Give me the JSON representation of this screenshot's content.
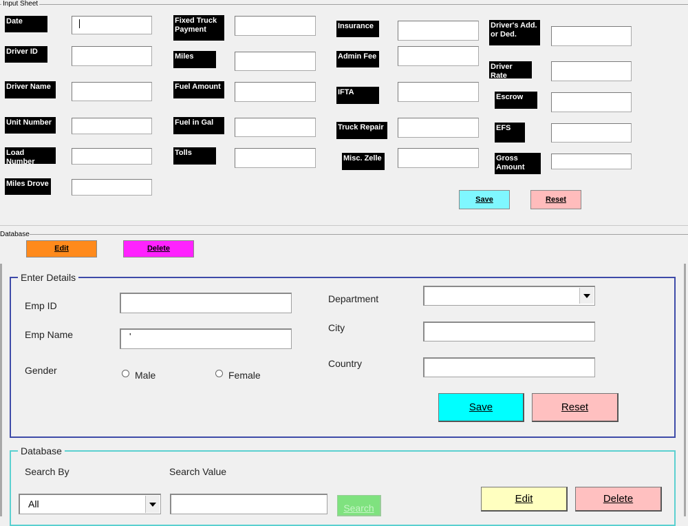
{
  "input_sheet": {
    "title": "Input Sheet",
    "fields": {
      "date": "Date",
      "driver_id": "Driver ID",
      "driver_name": "Driver Name",
      "unit_number": "Unit Number",
      "load_number": "Load Number",
      "miles_drove": "Miles Drove",
      "fixed_truck_payment": "Fixed Truck Payment",
      "miles": "Miles",
      "fuel_amount": "Fuel Amount",
      "fuel_in_gal": "Fuel in Gal",
      "tolls": "Tolls",
      "insurance": "Insurance",
      "admin_fee": "Admin Fee",
      "ifta": "IFTA",
      "truck_repair": "Truck Repair",
      "misc_zelle": "Misc. Zelle",
      "drivers_add_or_ded": "Driver's Add. or Ded.",
      "driver_rate": "Driver Rate",
      "escrow": "Escrow",
      "efs": "EFS",
      "gross_amount": "Gross Amount"
    },
    "save_label": "Save",
    "reset_label": "Reset"
  },
  "database_bar": {
    "title": "Database",
    "edit_label": "Edit",
    "delete_label": "Delete"
  },
  "enter_details": {
    "title": "Enter Details",
    "emp_id_label": "Emp ID",
    "emp_name_label": "Emp Name",
    "emp_name_value": "'",
    "gender_label": "Gender",
    "male_label": "Male",
    "female_label": "Female",
    "department_label": "Department",
    "city_label": "City",
    "country_label": "Country",
    "save_label": "Save",
    "reset_label": "Reset"
  },
  "database_section": {
    "title": "Database",
    "search_by_label": "Search By",
    "search_value_label": "Search Value",
    "search_by_value": "All",
    "search_label": "Search",
    "edit_label": "Edit",
    "delete_label": "Delete"
  },
  "colors": {
    "save_cyan": "#7ff7ff",
    "reset_pink": "#ffbcbc",
    "edit_orange": "#ff8a1c",
    "delete_magenta": "#ff22ff",
    "group_blue": "#3d4aa8",
    "group_teal": "#5ad0d0",
    "edit_yellow": "#ffffc0",
    "search_green": "#7fe27f"
  }
}
